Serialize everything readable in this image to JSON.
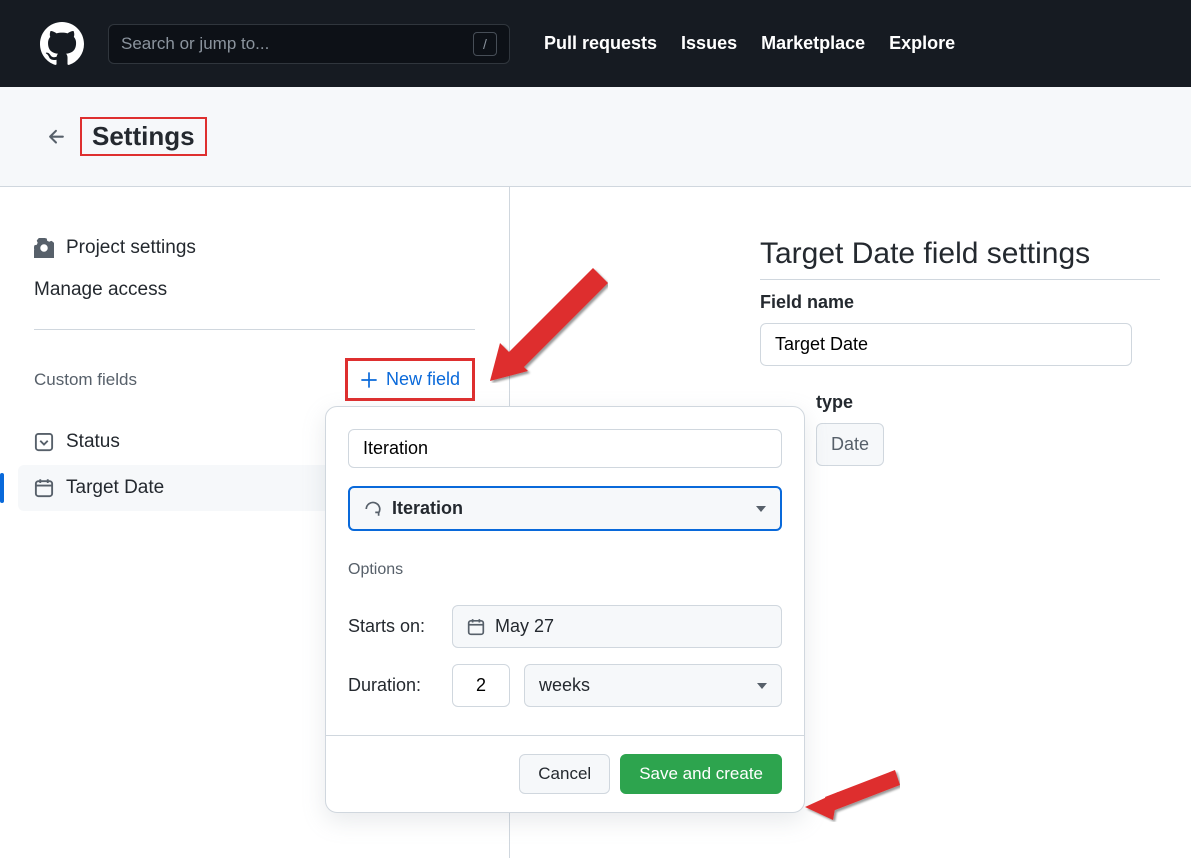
{
  "header": {
    "search_placeholder": "Search or jump to...",
    "slash": "/",
    "nav": [
      "Pull requests",
      "Issues",
      "Marketplace",
      "Explore"
    ]
  },
  "title_bar": {
    "title": "Settings"
  },
  "sidebar": {
    "project_settings": "Project settings",
    "manage_access": "Manage access",
    "custom_fields_label": "Custom fields",
    "new_field_label": "New field",
    "fields": [
      {
        "label": "Status"
      },
      {
        "label": "Target Date"
      }
    ]
  },
  "right": {
    "title": "Target Date field settings",
    "field_name_label": "Field name",
    "field_name_value": "Target Date",
    "type_label": "type",
    "type_value": "Date"
  },
  "dialog": {
    "name_value": "Iteration",
    "type_value": "Iteration",
    "options_label": "Options",
    "starts_on_label": "Starts on:",
    "starts_on_value": "May 27",
    "duration_label": "Duration:",
    "duration_value": "2",
    "duration_unit": "weeks",
    "cancel": "Cancel",
    "save": "Save and create"
  }
}
